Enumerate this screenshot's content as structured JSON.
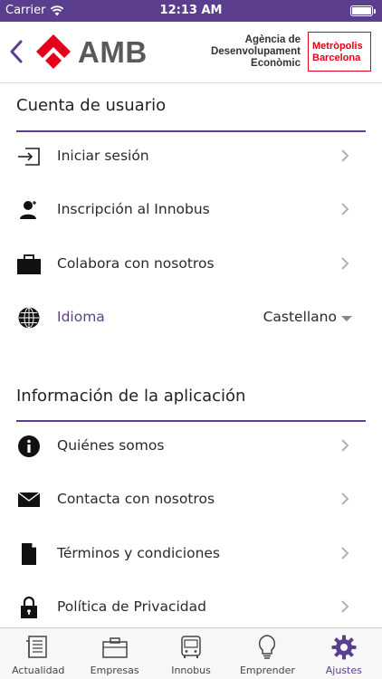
{
  "status_bar": {
    "carrier": "Carrier",
    "time": "12:13 AM"
  },
  "header": {
    "brand": "AMB",
    "agency_lines": [
      "Agència de",
      "Desenvolupament",
      "Econòmic"
    ],
    "partner_lines": [
      "Metròpolis",
      "Barcelona"
    ]
  },
  "sections": [
    {
      "title": "Cuenta de usuario",
      "items": [
        {
          "label": "Iniciar sesión",
          "icon": "login-icon"
        },
        {
          "label": "Inscripción al Innobus",
          "icon": "person-icon"
        },
        {
          "label": "Colabora con nosotros",
          "icon": "briefcase-icon"
        },
        {
          "label": "Idioma",
          "icon": "globe-icon",
          "value": "Castellano"
        }
      ]
    },
    {
      "title": "Información de la aplicación",
      "items": [
        {
          "label": "Quiénes somos",
          "icon": "info-icon"
        },
        {
          "label": "Contacta con nosotros",
          "icon": "envelope-icon"
        },
        {
          "label": "Términos y condiciones",
          "icon": "document-icon"
        },
        {
          "label": "Política de Privacidad",
          "icon": "lock-icon"
        }
      ]
    }
  ],
  "tabs": [
    {
      "label": "Actualidad",
      "icon": "newspaper-icon"
    },
    {
      "label": "Empresas",
      "icon": "briefcase-icon"
    },
    {
      "label": "Innobus",
      "icon": "bus-icon"
    },
    {
      "label": "Emprender",
      "icon": "lightbulb-icon"
    },
    {
      "label": "Ajustes",
      "icon": "gear-icon",
      "active": true
    }
  ],
  "colors": {
    "accent": "#5b3f8e",
    "brand_red": "#e2001a",
    "text": "#2a2a2a"
  }
}
